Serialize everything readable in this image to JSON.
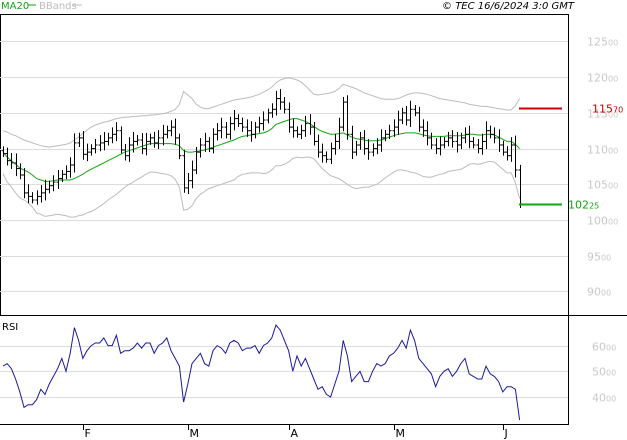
{
  "header": {
    "legend_ma": "MA20",
    "legend_bb": "BBands",
    "copyright": "© TEC 16/6/2024 3:0 GMT"
  },
  "colors": {
    "bars": "#000000",
    "ma": "#12a612",
    "bands": "#bcbcbc",
    "rsi": "#1a1aa0",
    "target_high": "#cc0000",
    "target_low": "#12a612",
    "grid": "#dcdcdc",
    "ytick": "#c9c9c9"
  },
  "chart_data": [
    {
      "type": "ohlc",
      "yticks": [
        {
          "main": "125",
          "small": "00",
          "value": 12500
        },
        {
          "main": "120",
          "small": "00",
          "value": 12000
        },
        {
          "main": "115",
          "small": "00",
          "value": 11500
        },
        {
          "main": "110",
          "small": "00",
          "value": 11000
        },
        {
          "main": "105",
          "small": "00",
          "value": 10500
        },
        {
          "main": "100",
          "small": "00",
          "value": 10000
        },
        {
          "main": "95",
          "small": "00",
          "value": 9500
        },
        {
          "main": "90",
          "small": "00",
          "value": 9000
        }
      ],
      "ylim": [
        8670,
        12870
      ],
      "x_labels": [
        "F",
        "M",
        "A",
        "M",
        "J"
      ],
      "x_label_index": [
        19,
        44,
        68,
        93,
        119
      ],
      "targets": [
        {
          "main": "115",
          "small": "70",
          "value": 11570,
          "role": "high"
        },
        {
          "main": "102",
          "small": "25",
          "value": 10225,
          "role": "low"
        }
      ],
      "closes": [
        10930,
        10830,
        10800,
        10720,
        10630,
        10380,
        10330,
        10280,
        10330,
        10380,
        10430,
        10480,
        10530,
        10580,
        10640,
        10680,
        10770,
        11080,
        11150,
        10920,
        10950,
        11000,
        11050,
        11080,
        11100,
        11150,
        11200,
        11250,
        10980,
        10900,
        11050,
        11100,
        11120,
        11000,
        11100,
        11150,
        11080,
        11150,
        11200,
        11250,
        11300,
        11150,
        10900,
        10450,
        10550,
        10700,
        10950,
        11050,
        11100,
        11000,
        11200,
        11250,
        11300,
        11200,
        11350,
        11420,
        11350,
        11300,
        11250,
        11200,
        11300,
        11350,
        11400,
        11500,
        11550,
        11700,
        11650,
        11550,
        11300,
        11250,
        11200,
        11250,
        11350,
        11300,
        11100,
        10950,
        10900,
        10850,
        11000,
        11100,
        11300,
        11650,
        11200,
        10950,
        11050,
        11150,
        11000,
        10950,
        11000,
        11050,
        11150,
        11200,
        11250,
        11300,
        11400,
        11500,
        11400,
        11550,
        11500,
        11300,
        11250,
        11150,
        11050,
        11000,
        11050,
        11100,
        11150,
        11100,
        11050,
        11150,
        11200,
        11100,
        11050,
        11000,
        11100,
        11250,
        11200,
        11150,
        11050,
        10950,
        10900,
        11050,
        10700,
        10225
      ],
      "ma20": [
        10950,
        10880,
        10830,
        10780,
        10730,
        10700,
        10670,
        10630,
        10580,
        10560,
        10540,
        10540,
        10550,
        10560,
        10560,
        10560,
        10560,
        10580,
        10610,
        10640,
        10680,
        10710,
        10740,
        10770,
        10800,
        10830,
        10860,
        10890,
        10920,
        10950,
        10970,
        10990,
        11010,
        11030,
        11050,
        11070,
        11070,
        11070,
        11070,
        11070,
        11070,
        11060,
        11040,
        10970,
        10950,
        10950,
        10960,
        10970,
        10980,
        11000,
        11020,
        11040,
        11060,
        11080,
        11100,
        11120,
        11150,
        11170,
        11180,
        11190,
        11200,
        11210,
        11220,
        11240,
        11280,
        11340,
        11360,
        11380,
        11400,
        11420,
        11420,
        11400,
        11380,
        11350,
        11310,
        11270,
        11240,
        11220,
        11200,
        11200,
        11210,
        11220,
        11190,
        11160,
        11140,
        11130,
        11120,
        11110,
        11110,
        11110,
        11120,
        11140,
        11160,
        11180,
        11200,
        11210,
        11220,
        11220,
        11220,
        11210,
        11190,
        11180,
        11170,
        11170,
        11170,
        11170,
        11180,
        11180,
        11180,
        11180,
        11190,
        11200,
        11200,
        11190,
        11190,
        11200,
        11200,
        11190,
        11160,
        11130,
        11100,
        11100,
        11060,
        11000
      ],
      "bb_upper": [
        11250,
        11230,
        11200,
        11180,
        11150,
        11120,
        11100,
        11080,
        11060,
        11040,
        11030,
        11020,
        11030,
        11040,
        11050,
        11060,
        11080,
        11120,
        11160,
        11210,
        11260,
        11300,
        11330,
        11350,
        11370,
        11380,
        11400,
        11420,
        11430,
        11440,
        11440,
        11450,
        11450,
        11460,
        11460,
        11470,
        11470,
        11480,
        11490,
        11500,
        11520,
        11550,
        11620,
        11800,
        11750,
        11700,
        11620,
        11580,
        11560,
        11560,
        11580,
        11600,
        11620,
        11640,
        11660,
        11680,
        11690,
        11700,
        11710,
        11720,
        11740,
        11760,
        11790,
        11820,
        11860,
        11920,
        11960,
        11980,
        11990,
        11980,
        11960,
        11930,
        11880,
        11820,
        11760,
        11750,
        11760,
        11770,
        11780,
        11800,
        11840,
        11900,
        11880,
        11860,
        11840,
        11810,
        11780,
        11760,
        11740,
        11720,
        11700,
        11690,
        11690,
        11690,
        11700,
        11720,
        11750,
        11770,
        11780,
        11780,
        11770,
        11760,
        11740,
        11720,
        11700,
        11690,
        11680,
        11670,
        11660,
        11650,
        11640,
        11620,
        11610,
        11600,
        11590,
        11590,
        11580,
        11570,
        11560,
        11550,
        11540,
        11540,
        11600,
        11700
      ],
      "bb_lower": [
        10650,
        10530,
        10460,
        10380,
        10310,
        10280,
        10240,
        10180,
        10100,
        10080,
        10050,
        10060,
        10070,
        10080,
        10070,
        10060,
        10040,
        10040,
        10060,
        10070,
        10100,
        10120,
        10150,
        10190,
        10230,
        10280,
        10320,
        10360,
        10410,
        10460,
        10500,
        10530,
        10570,
        10600,
        10640,
        10670,
        10670,
        10660,
        10650,
        10640,
        10620,
        10570,
        10460,
        10140,
        10150,
        10200,
        10300,
        10360,
        10400,
        10440,
        10460,
        10480,
        10500,
        10520,
        10540,
        10560,
        10610,
        10640,
        10650,
        10660,
        10660,
        10660,
        10650,
        10660,
        10700,
        10760,
        10760,
        10780,
        10810,
        10860,
        10880,
        10870,
        10880,
        10880,
        10860,
        10790,
        10720,
        10670,
        10620,
        10600,
        10580,
        10540,
        10500,
        10460,
        10440,
        10450,
        10460,
        10460,
        10480,
        10500,
        10540,
        10590,
        10630,
        10670,
        10700,
        10700,
        10690,
        10670,
        10660,
        10640,
        10610,
        10600,
        10600,
        10620,
        10640,
        10650,
        10680,
        10690,
        10700,
        10710,
        10740,
        10780,
        10790,
        10780,
        10790,
        10810,
        10820,
        10810,
        10760,
        10710,
        10660,
        10660,
        10520,
        10300
      ]
    },
    {
      "type": "line",
      "name": "RSI",
      "yticks": [
        {
          "main": "60",
          "small": "00",
          "value": 60
        },
        {
          "main": "50",
          "small": "00",
          "value": 50
        },
        {
          "main": "40",
          "small": "00",
          "value": 40
        }
      ],
      "ylim": [
        29.5,
        71.5
      ],
      "values": [
        52,
        53,
        51,
        47,
        42,
        36,
        37,
        37,
        39,
        43,
        41,
        45,
        48,
        51,
        55,
        50,
        57,
        67,
        62,
        55,
        58,
        60,
        61,
        61,
        63,
        60,
        60,
        64,
        57,
        58,
        58,
        59,
        61,
        59,
        61,
        61,
        57,
        60,
        61,
        63,
        58,
        55,
        52,
        38,
        45,
        53,
        55,
        57,
        53,
        52,
        58,
        60,
        59,
        57,
        61,
        62,
        61,
        58,
        59,
        59,
        60,
        57,
        60,
        61,
        63,
        68,
        66,
        62,
        58,
        50,
        56,
        52,
        55,
        51,
        47,
        43,
        44,
        41,
        40,
        45,
        50,
        62,
        56,
        46,
        48,
        50,
        46,
        46,
        50,
        53,
        52,
        53,
        56,
        57,
        59,
        62,
        59,
        66,
        62,
        55,
        53,
        51,
        49,
        44,
        48,
        50,
        51,
        48,
        50,
        53,
        55,
        49,
        48,
        47,
        47,
        52,
        49,
        48,
        46,
        42,
        44,
        44,
        43,
        31
      ]
    }
  ]
}
